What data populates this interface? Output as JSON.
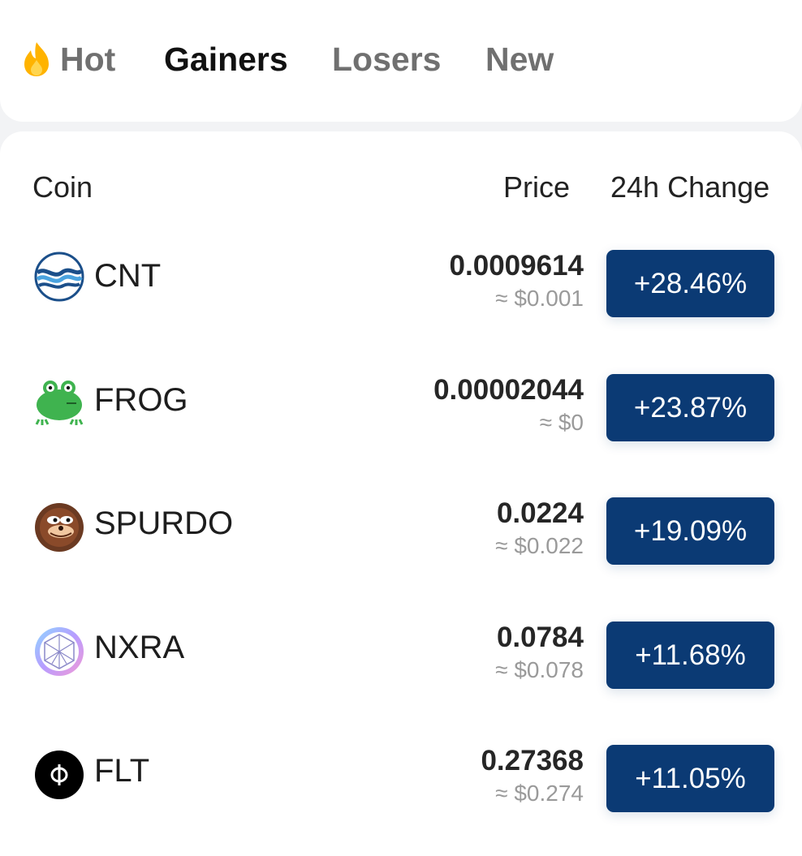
{
  "tabs": {
    "hot": "Hot",
    "gainers": "Gainers",
    "losers": "Losers",
    "new": "New",
    "active": "Gainers"
  },
  "table": {
    "col_coin": "Coin",
    "col_price": "Price",
    "col_change": "24h Change"
  },
  "colors": {
    "change_button": "#0b3a74",
    "fire": "#ffb300"
  },
  "coins": [
    {
      "symbol": "CNT",
      "price": "0.0009614",
      "usd": "≈ $0.001",
      "change": "+28.46%",
      "icon": "cnt-wave-icon"
    },
    {
      "symbol": "FROG",
      "price": "0.00002044",
      "usd": "≈ $0",
      "change": "+23.87%",
      "icon": "frog-icon"
    },
    {
      "symbol": "SPURDO",
      "price": "0.0224",
      "usd": "≈ $0.022",
      "change": "+19.09%",
      "icon": "spurdo-bear-icon"
    },
    {
      "symbol": "NXRA",
      "price": "0.0784",
      "usd": "≈ $0.078",
      "change": "+11.68%",
      "icon": "nxra-crystal-icon"
    },
    {
      "symbol": "FLT",
      "price": "0.27368",
      "usd": "≈ $0.274",
      "change": "+11.05%",
      "icon": "flt-phi-icon"
    }
  ]
}
